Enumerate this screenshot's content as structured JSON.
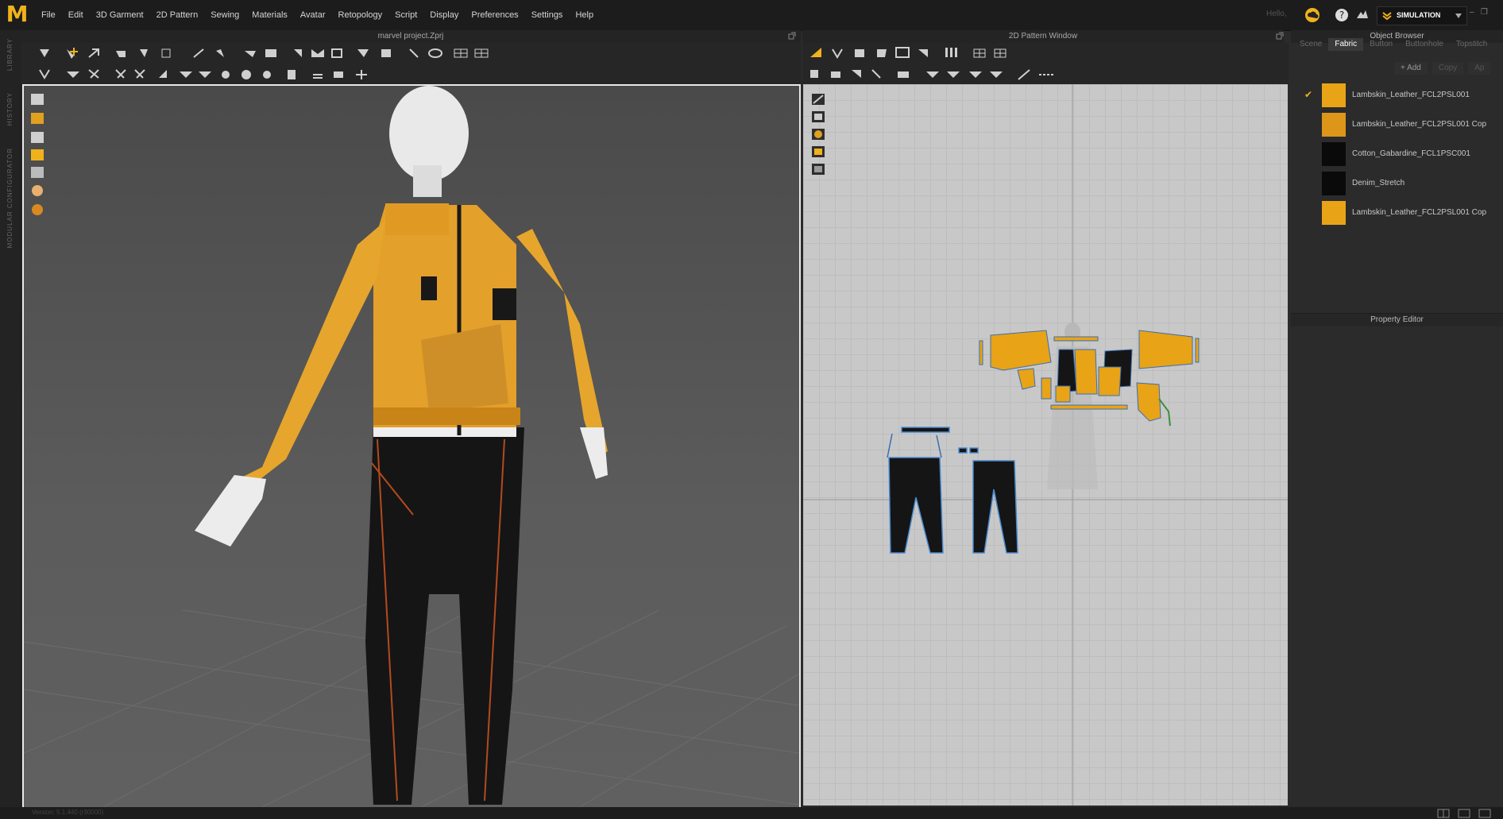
{
  "app": {
    "logo": "M"
  },
  "menu": [
    "File",
    "Edit",
    "3D Garment",
    "2D Pattern",
    "Sewing",
    "Materials",
    "Avatar",
    "Retopology",
    "Script",
    "Display",
    "Preferences",
    "Settings",
    "Help"
  ],
  "topbar": {
    "hello": "Hello,",
    "mode": "SIMULATION",
    "accent": "#f0b21c"
  },
  "left_rail": [
    "LIBRARY",
    "HISTORY",
    "MODULAR CONFIGURATOR"
  ],
  "panel3d": {
    "title": "marvel project.Zprj"
  },
  "panel2d": {
    "title": "2D Pattern Window"
  },
  "object_browser": {
    "title": "Object Browser",
    "tabs": [
      "Scene",
      "Fabric",
      "Button",
      "Buttonhole",
      "Topstitch"
    ],
    "active_tab": "Fabric",
    "buttons": [
      "+ Add",
      "Copy",
      "Ap"
    ],
    "fabrics": [
      {
        "name": "Lambskin_Leather_FCL2PSL001",
        "color": "#e8a317",
        "checked": true
      },
      {
        "name": "Lambskin_Leather_FCL2PSL001 Cop",
        "color": "#dd961a",
        "checked": false
      },
      {
        "name": "Cotton_Gabardine_FCL1PSC001",
        "color": "#0a0a0a",
        "checked": false
      },
      {
        "name": "Denim_Stretch",
        "color": "#0a0a0a",
        "checked": false
      },
      {
        "name": "Lambskin_Leather_FCL2PSL001 Cop",
        "color": "#e8a317",
        "checked": false
      }
    ]
  },
  "property_editor": {
    "title": "Property Editor"
  },
  "status": {
    "version": "Version: 5.1.440 (r30000)"
  }
}
